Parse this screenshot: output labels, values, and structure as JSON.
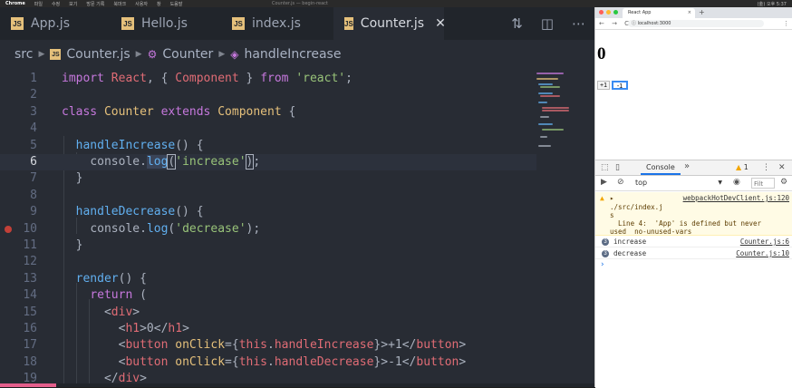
{
  "menubar": {
    "app": "Chrome",
    "items": [
      "파일",
      "수정",
      "보기",
      "방문 기록",
      "북마크",
      "사용자",
      "창",
      "도움말"
    ],
    "center": "Counter.js — begin-react",
    "right": "(金) 오후 5:37"
  },
  "editor": {
    "tabs": [
      {
        "label": "App.js"
      },
      {
        "label": "Hello.js"
      },
      {
        "label": "index.js"
      },
      {
        "label": "Counter.js",
        "active": true
      }
    ],
    "tab_close_glyph": "✕",
    "tool_icons": [
      "split-diff-icon",
      "split-editor-icon",
      "more-icon"
    ],
    "breadcrumb": {
      "folder": "src",
      "file": "Counter.js",
      "class": "Counter",
      "method": "handleIncrease"
    },
    "code_lines": [
      {
        "n": "1",
        "html": "<span class=\"k\">import</span> <span class=\"n\">React</span>, { <span class=\"n\">Component</span> } <span class=\"k\">from</span> <span class=\"s\">'react'</span>;"
      },
      {
        "n": "2",
        "html": ""
      },
      {
        "n": "3",
        "html": "<span class=\"k\">class</span> <span class=\"c\">Counter</span> <span class=\"k\">extends</span> <span class=\"c\">Component</span> {"
      },
      {
        "n": "4",
        "html": ""
      },
      {
        "n": "5",
        "html": "  <span class=\"f\">handleIncrease</span>() {"
      },
      {
        "n": "6",
        "html": "    <span class=\"d\">console</span>.<span class=\"f hl\">log</span><span class=\"bracket\">(</span><span class=\"s\">'increase'</span><span class=\"bracket\">)</span>;",
        "current": true
      },
      {
        "n": "7",
        "html": "  }"
      },
      {
        "n": "8",
        "html": ""
      },
      {
        "n": "9",
        "html": "  <span class=\"f\">handleDecrease</span>() {"
      },
      {
        "n": "10",
        "html": "    <span class=\"d\">console</span>.<span class=\"f\">log</span>(<span class=\"s\">'decrease'</span>);",
        "breakpoint": true
      },
      {
        "n": "11",
        "html": "  }"
      },
      {
        "n": "12",
        "html": ""
      },
      {
        "n": "13",
        "html": "  <span class=\"f\">render</span>() {"
      },
      {
        "n": "14",
        "html": "    <span class=\"k\">return</span> ("
      },
      {
        "n": "15",
        "html": "      &lt;<span class=\"n\">div</span>&gt;"
      },
      {
        "n": "16",
        "html": "        &lt;<span class=\"n\">h1</span>&gt;0&lt;/<span class=\"n\">h1</span>&gt;"
      },
      {
        "n": "17",
        "html": "        &lt;<span class=\"n\">button</span> <span class=\"c\">onClick</span>={<span class=\"n\">this</span>.<span class=\"n\">handleIncrease</span>}&gt;+1&lt;/<span class=\"n\">button</span>&gt;"
      },
      {
        "n": "18",
        "html": "        &lt;<span class=\"n\">button</span> <span class=\"c\">onClick</span>={<span class=\"n\">this</span>.<span class=\"n\">handleDecrease</span>}&gt;-1&lt;/<span class=\"n\">button</span>&gt;"
      },
      {
        "n": "19",
        "html": "      &lt;/<span class=\"n\">div</span>&gt;"
      }
    ],
    "colors": {
      "keyword": "#c678dd",
      "tag": "#e06c75",
      "string": "#98c379",
      "class": "#e5c07b",
      "function": "#61afef"
    }
  },
  "browser": {
    "tab_title": "React App",
    "tab_close": "×",
    "new_tab": "+",
    "nav_glyphs": "← → C",
    "url": "ⓘ localhost:3000",
    "menu_glyph": "⋮",
    "page": {
      "heading": "0",
      "buttons": [
        "+1",
        "-1"
      ]
    },
    "devtools": {
      "active_tab": "Console",
      "more_tabs": "»",
      "warning_count": "1",
      "context": "top",
      "filter_placeholder": "Filt",
      "messages": [
        {
          "type": "warn",
          "source": "webpackHotDevClient.js:120",
          "lines": [
            "./src/index.j",
            "s",
            "  Line 4:  'App' is defined but never",
            "used  no-unused-vars"
          ]
        },
        {
          "type": "log",
          "count": "3",
          "text": "increase",
          "source": "Counter.js:6"
        },
        {
          "type": "log",
          "count": "3",
          "text": "decrease",
          "source": "Counter.js:10"
        }
      ],
      "prompt": "›"
    }
  }
}
